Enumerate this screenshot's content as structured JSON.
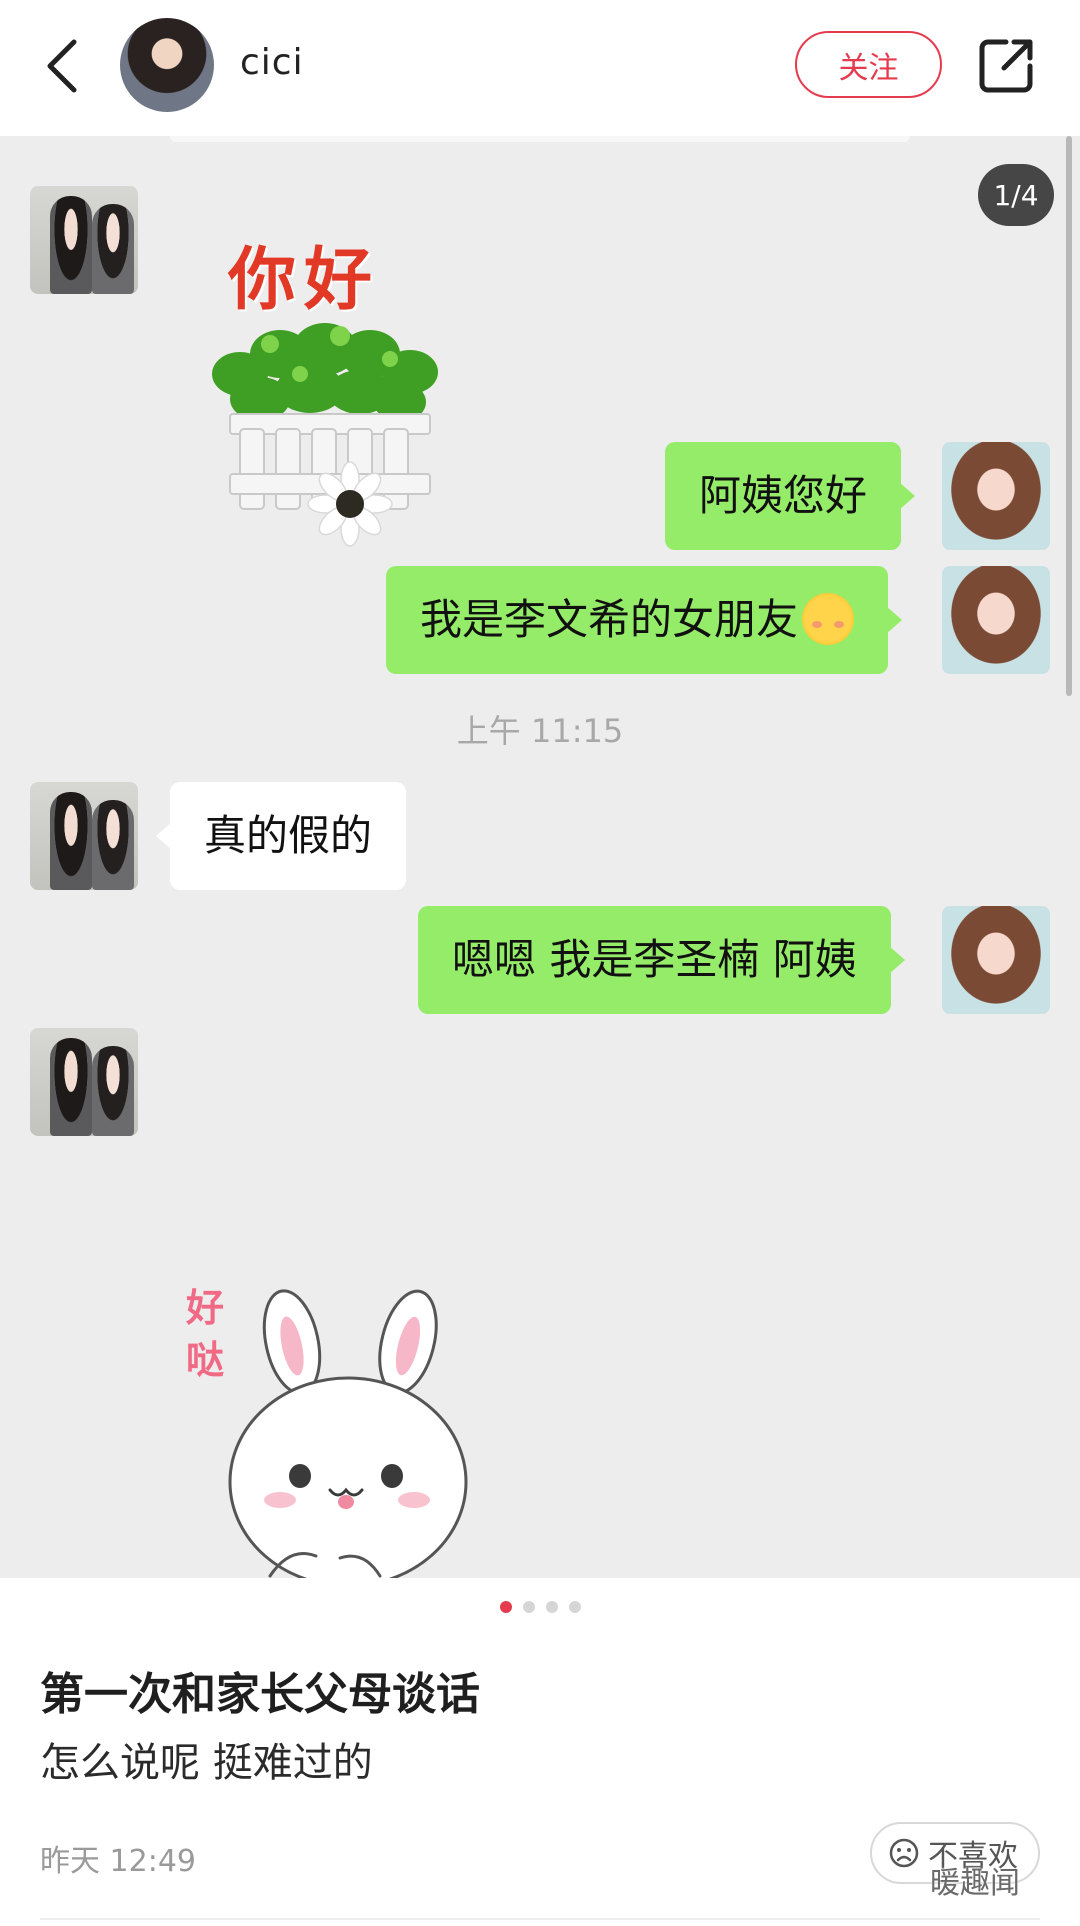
{
  "header": {
    "username": "cici",
    "follow_label": "关注"
  },
  "screenshot": {
    "page_indicator": "1/4",
    "messages": {
      "msg1": "阿姨您好",
      "msg2": "我是李文希的女朋友",
      "time": "上午 11:15",
      "msg3": "真的假的",
      "msg4": "嗯嗯 我是李圣楠 阿姨"
    },
    "sticker_hello_text": "你好",
    "sticker_bunny_text": "好哒"
  },
  "carousel": {
    "total": 4,
    "active": 1
  },
  "post": {
    "title": "第一次和家长父母谈话",
    "body": "怎么说呢 挺难过的",
    "time": "昨天 12:49",
    "dislike_label": "不喜欢"
  },
  "watermark": "暖趣闻"
}
